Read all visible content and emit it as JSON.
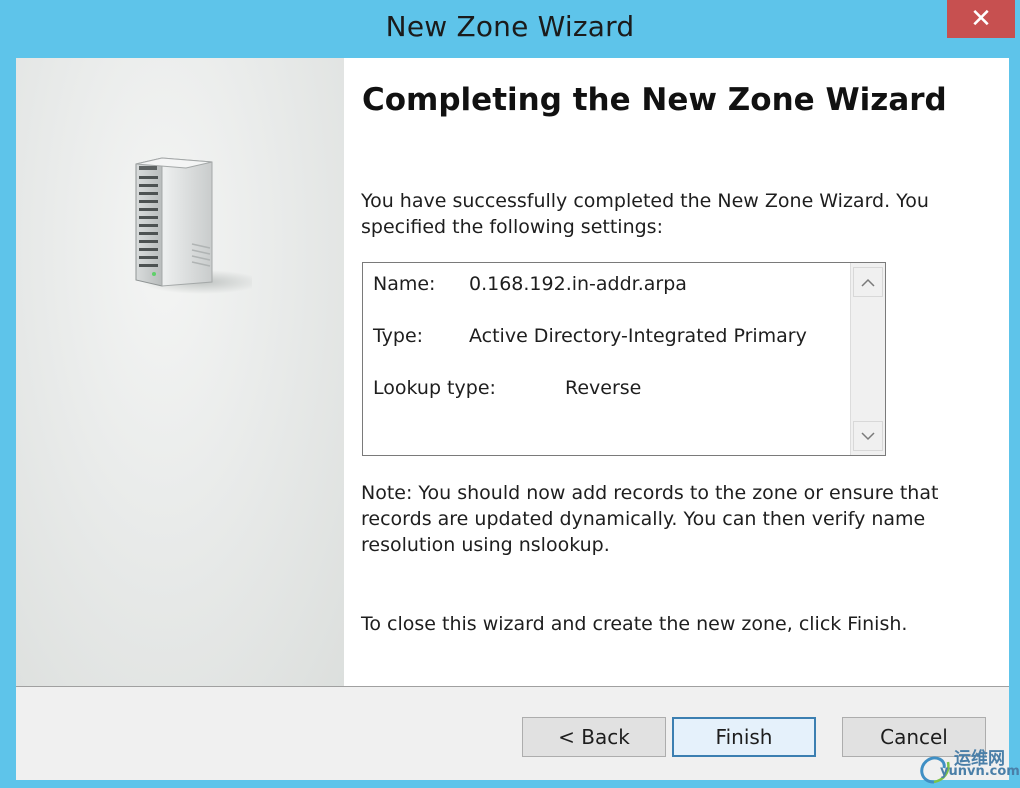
{
  "window": {
    "title": "New Zone Wizard",
    "close_label": "✕"
  },
  "wizard": {
    "heading": "Completing the New Zone Wizard",
    "intro": "You have successfully completed the New Zone Wizard. You specified the following settings:",
    "settings": [
      {
        "label": "Name:",
        "value": "0.168.192.in-addr.arpa"
      },
      {
        "label": "Type:",
        "value": "Active Directory-Integrated Primary"
      },
      {
        "label": "Lookup type:",
        "value": "Reverse"
      }
    ],
    "note": "Note: You should now add records to the zone or ensure that records are updated dynamically. You can then verify name resolution using nslookup.",
    "close_instruction": "To close this wizard and create the new zone, click Finish."
  },
  "buttons": {
    "back": "< Back",
    "finish": "Finish",
    "cancel": "Cancel"
  },
  "icons": {
    "server": "server-tower-icon",
    "scroll_up": "chevron-up-icon",
    "scroll_down": "chevron-down-icon"
  },
  "watermark": {
    "cn": "运维网",
    "en": "yunvn.com"
  },
  "colors": {
    "titlebar": "#5ec4ea",
    "close_button": "#c75050",
    "default_button_border": "#3c7fb1"
  }
}
